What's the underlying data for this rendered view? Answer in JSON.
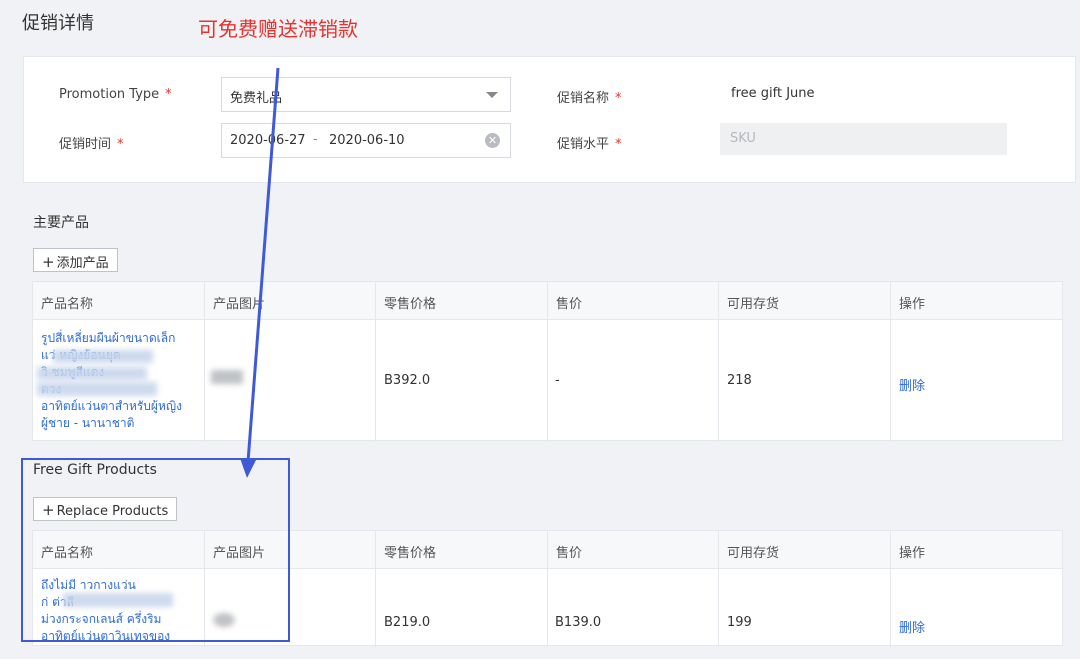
{
  "page": {
    "title": "促销详情",
    "annotation": "可免费赠送滞销款"
  },
  "form": {
    "promotion_type_label": "Promotion Type",
    "promotion_type_value": "免费礼品",
    "promotion_time_label": "促销时间",
    "date_start": "2020-06-27",
    "date_sep": "-",
    "date_end": "2020-06-10",
    "promotion_name_label": "促销名称",
    "promotion_name_value": "free gift June",
    "promotion_level_label": "促销水平",
    "promotion_level_value": "SKU",
    "required_mark": "*"
  },
  "main_products": {
    "title": "主要产品",
    "add_button": "添加产品",
    "columns": [
      "产品名称",
      "产品图片",
      "零售价格",
      "售价",
      "可用存货",
      "操作"
    ],
    "rows": [
      {
        "name_lines": [
          "รูปสี่เหลี่ยมผืนผ้าขนาดเล็ก",
          "แว่ หญิงย้อนยุค",
          "วิ ชมพูสีแดง",
          " ดวง",
          "อาทิตย์แว่นตาสำหรับผู้หญิง",
          "ผู้ชาย - นานาชาติ"
        ],
        "retail_price": "B392.0",
        "sale_price": "-",
        "stock": "218",
        "action": "删除"
      }
    ]
  },
  "gift_products": {
    "title": "Free Gift Products",
    "replace_button": "Replace Products",
    "columns": [
      "产品名称",
      "产品图片",
      "零售价格",
      "售价",
      "可用存货",
      "操作"
    ],
    "rows": [
      {
        "name_lines": [
          "ถึงไม่มี าวกางแว่น",
          "ก่ ต่าสี",
          "ม่วงกระจกเลนส์ ครึ่งริม",
          "อาทิตย์แว่นตาวินเทจของ"
        ],
        "retail_price": "B219.0",
        "sale_price": "B139.0",
        "stock": "199",
        "action": "删除"
      }
    ]
  },
  "colors": {
    "annotation_red": "#e8322f",
    "link_blue": "#2d6bd7",
    "highlight_blue": "#3f5ad6"
  }
}
